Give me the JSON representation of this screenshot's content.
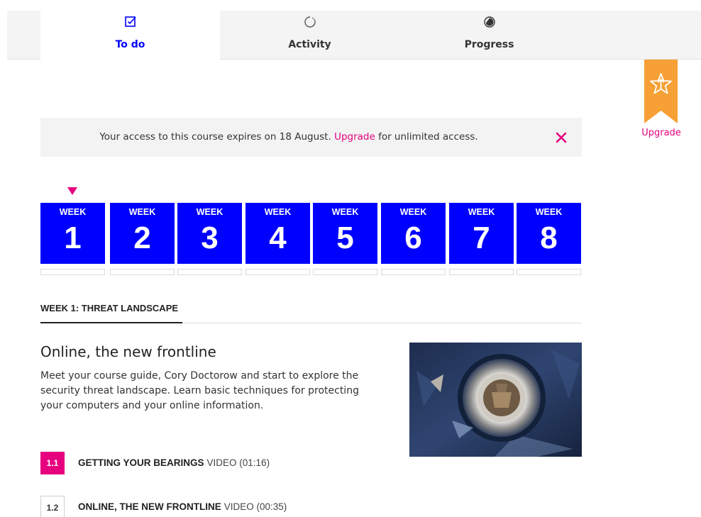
{
  "tabs": [
    {
      "label": "To do",
      "icon": "checkbox-edit-icon",
      "active": true
    },
    {
      "label": "Activity",
      "icon": "activity-spinner-icon",
      "active": false
    },
    {
      "label": "Progress",
      "icon": "progress-circle-icon",
      "active": false
    }
  ],
  "upgrade_ribbon": {
    "label": "Upgrade",
    "icon": "star-upload-icon",
    "color": "#f7a035"
  },
  "banner": {
    "text_before": "Your access to this course expires on 18 August. ",
    "link": "Upgrade",
    "text_after": " for unlimited access.",
    "close_icon": "close-icon"
  },
  "weeks": {
    "label": "WEEK",
    "items": [
      "1",
      "2",
      "3",
      "4",
      "5",
      "6",
      "7",
      "8"
    ],
    "selected_index": 0,
    "tile_color": "#0000ff"
  },
  "week_heading": "WEEK 1: THREAT LANDSCAPE",
  "section": {
    "title": "Online, the new frontline",
    "description": "Meet your course guide, Cory Doctorow and start to explore the security threat landscape. Learn basic techniques for protecting your computers and your online information."
  },
  "steps": [
    {
      "number": "1.1",
      "title": "GETTING YOUR BEARINGS",
      "type": "VIDEO (01:16)",
      "active": true
    },
    {
      "number": "1.2",
      "title": "ONLINE, THE NEW FRONTLINE",
      "type": "VIDEO (00:35)",
      "active": false
    }
  ],
  "colors": {
    "accent": "#e6007e",
    "brand_blue": "#0000ff"
  }
}
